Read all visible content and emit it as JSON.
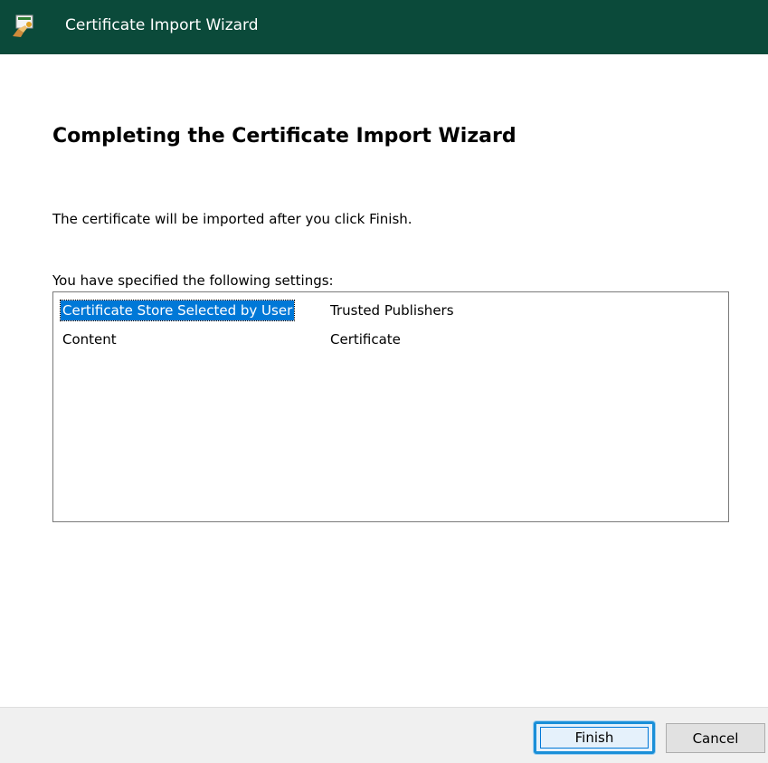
{
  "window": {
    "title": "Certificate Import Wizard",
    "icon": "certificate-wizard-icon",
    "title_bar_color": "#0b4a3a"
  },
  "content": {
    "heading": "Completing the Certificate Import Wizard",
    "info_text": "The certificate will be imported after you click Finish.",
    "settings_label": "You have specified the following settings:",
    "settings": [
      {
        "key": "Certificate Store Selected by User",
        "value": "Trusted Publishers",
        "selected": true
      },
      {
        "key": "Content",
        "value": "Certificate",
        "selected": false
      }
    ]
  },
  "footer": {
    "finish_label": "Finish",
    "cancel_label": "Cancel"
  },
  "colors": {
    "selection": "#0078d7",
    "focus_ring": "#1a8fd8"
  }
}
